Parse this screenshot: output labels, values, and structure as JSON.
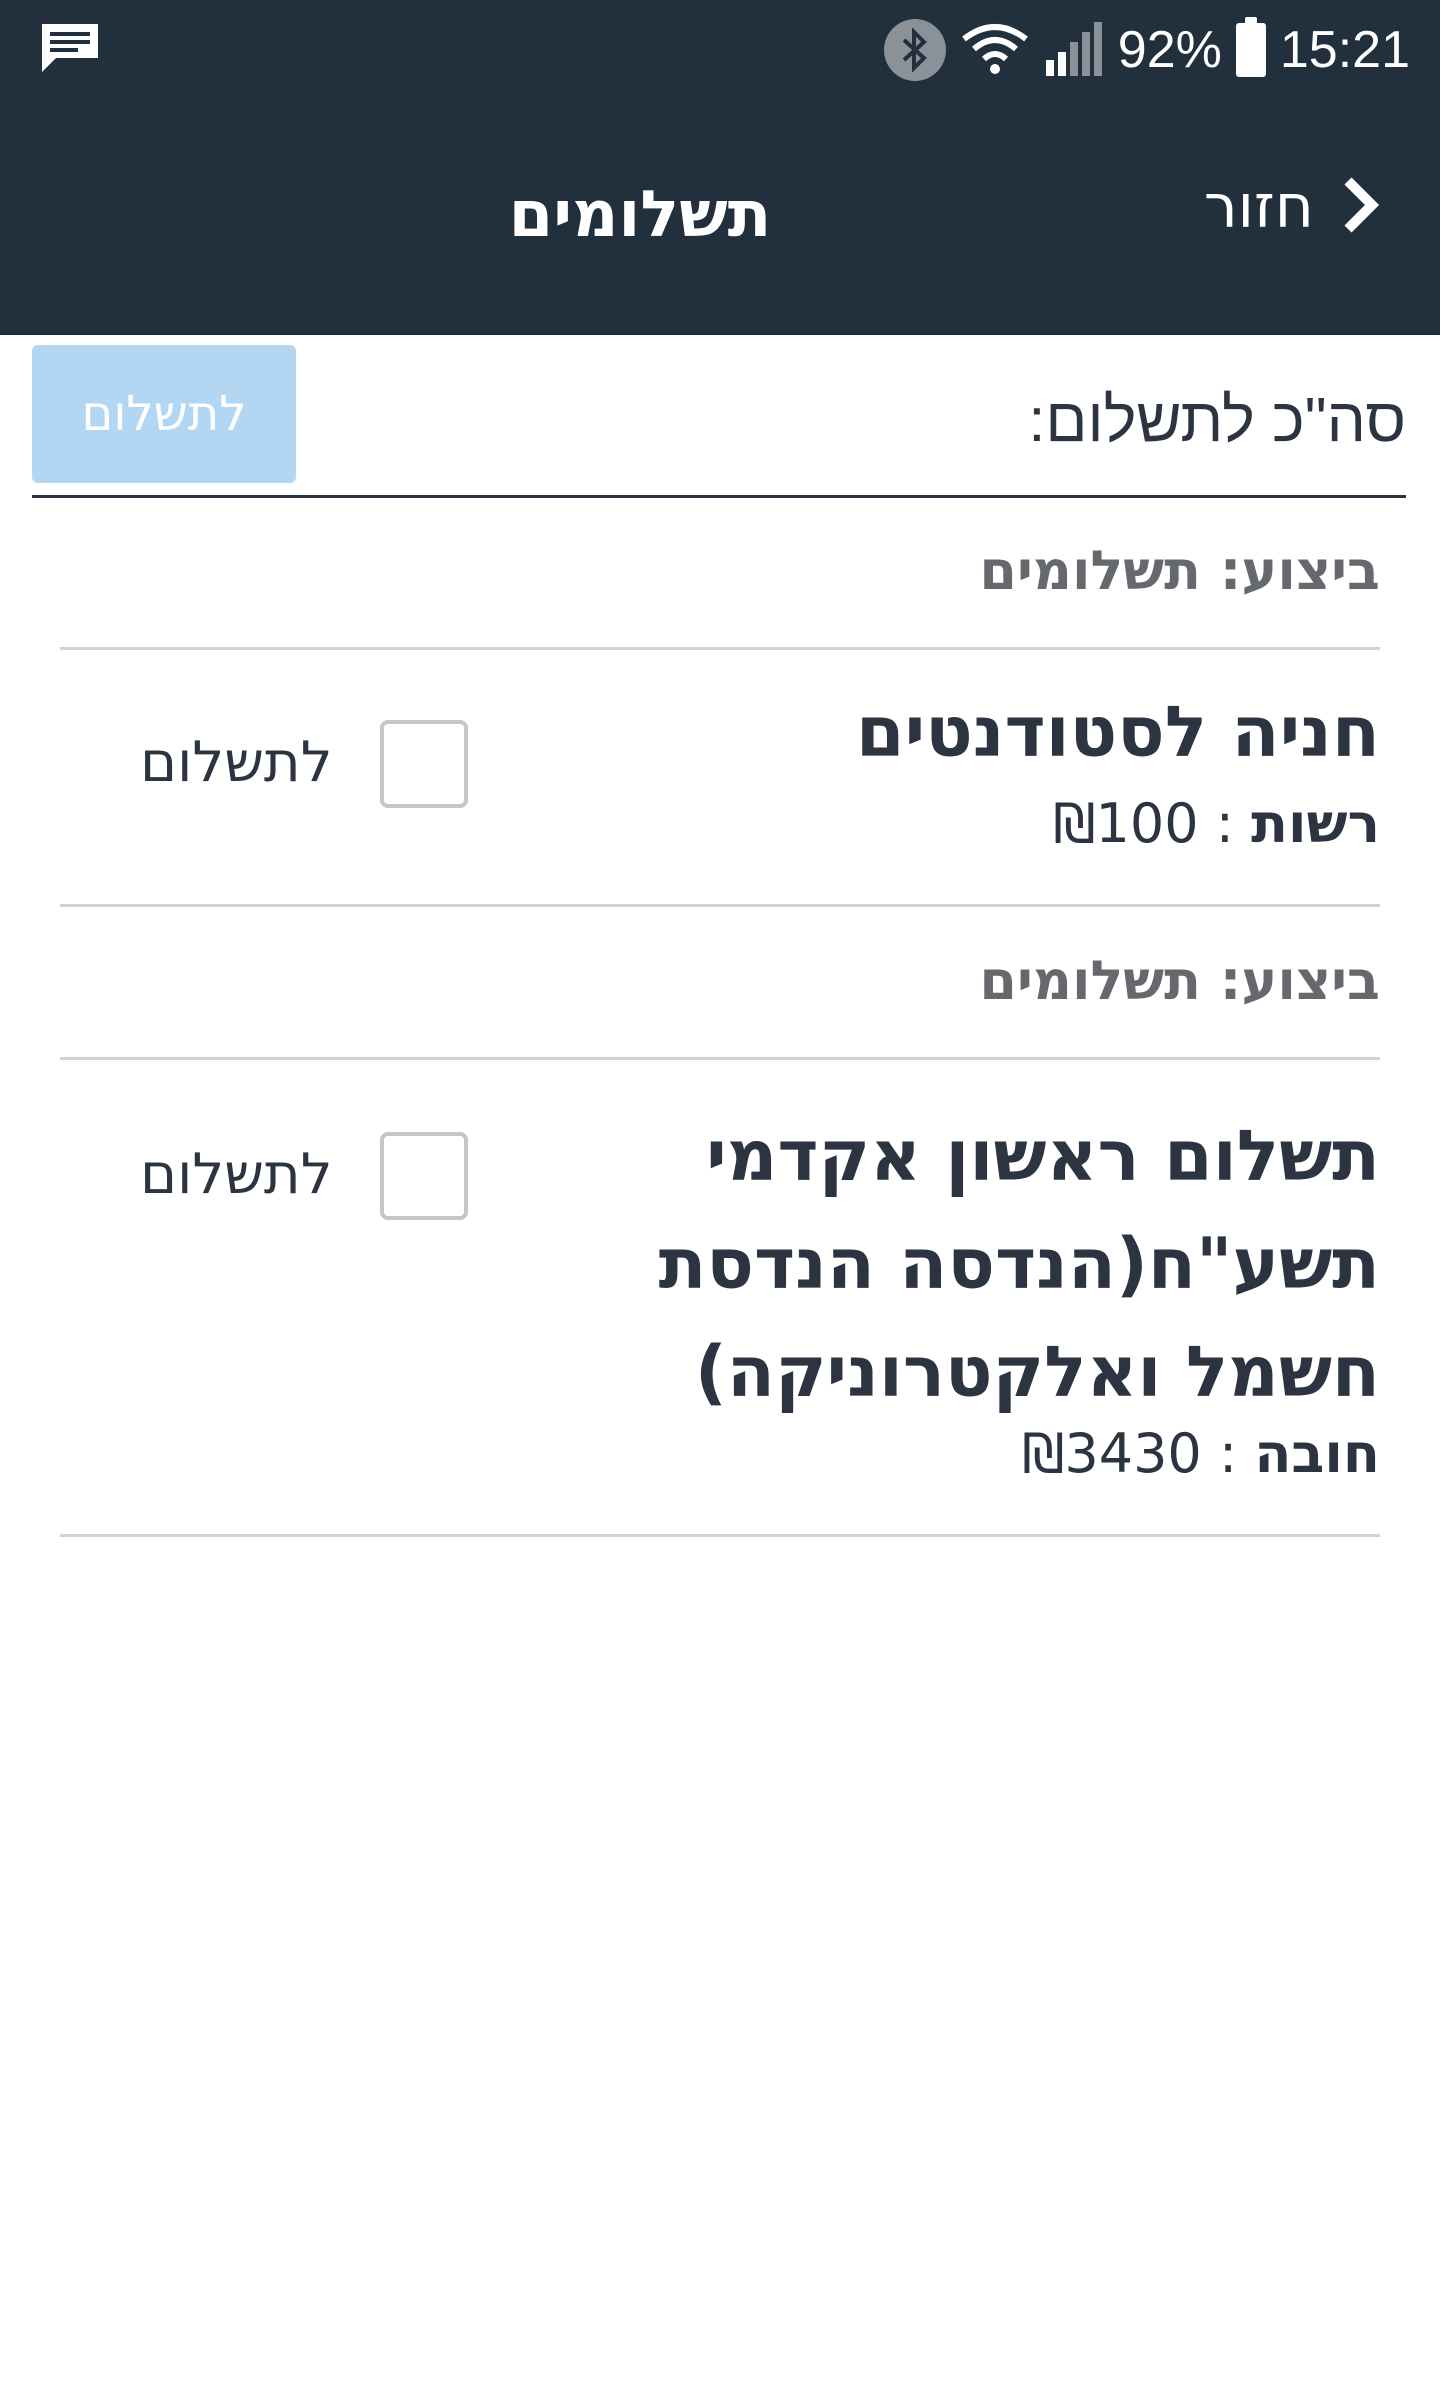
{
  "status_bar": {
    "battery_percent": "92%",
    "time": "15:21",
    "icons": [
      "message-icon",
      "bluetooth-icon",
      "wifi-icon",
      "signal-icon",
      "battery-icon"
    ]
  },
  "header": {
    "title": "תשלומים",
    "back_label": "חזור"
  },
  "summary": {
    "total_label": "סה\"כ לתשלום:",
    "pay_button_label": "לתשלום"
  },
  "sections": [
    {
      "header": "ביצוע: תשלומים",
      "item": {
        "name": "חניה לסטודנטים",
        "amount_label": "רשות",
        "amount_value": "₪100",
        "checkbox_label": "לתשלום"
      }
    },
    {
      "header": "ביצוע: תשלומים",
      "item": {
        "name": "תשלום ראשון אקדמי תשע\"ח(הנדסה הנדסת חשמל ואלקטרוניקה)",
        "amount_label": "חובה",
        "amount_value": "₪3430",
        "checkbox_label": "לתשלום"
      }
    }
  ],
  "colors": {
    "header_bg": "#222f3c",
    "pay_button_bg": "#b3d7f3",
    "text": "#2b3440",
    "section_header_text": "#65696e"
  }
}
